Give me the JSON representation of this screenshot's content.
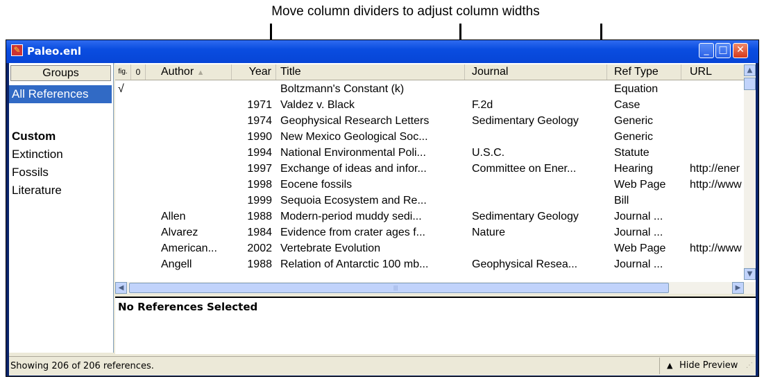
{
  "callout": {
    "text": "Move column dividers to adjust column widths"
  },
  "window": {
    "title": "Paleo.enl"
  },
  "title_buttons": {
    "minimize": "_",
    "maximize": "□",
    "close": "✕"
  },
  "groups": {
    "header": "Groups",
    "all_references": "All References",
    "custom_header": "Custom",
    "items": [
      "Extinction",
      "Fossils",
      "Literature"
    ]
  },
  "columns": {
    "figure": "fig.",
    "attachment": "0",
    "author": "Author",
    "sort_indicator": "▲",
    "year": "Year",
    "title": "Title",
    "journal": "Journal",
    "reftype": "Ref Type",
    "url": "URL"
  },
  "references": [
    {
      "check": "√",
      "author": "",
      "year": "",
      "title": "Boltzmann's Constant (k)",
      "journal": "",
      "reftype": "Equation",
      "url": ""
    },
    {
      "check": "",
      "author": "",
      "year": "1971",
      "title": "Valdez v. Black",
      "journal": "F.2d",
      "reftype": "Case",
      "url": ""
    },
    {
      "check": "",
      "author": "",
      "year": "1974",
      "title": "Geophysical Research Letters",
      "journal": "Sedimentary Geology",
      "reftype": "Generic",
      "url": ""
    },
    {
      "check": "",
      "author": "",
      "year": "1990",
      "title": "New Mexico Geological Soc...",
      "journal": "",
      "reftype": "Generic",
      "url": ""
    },
    {
      "check": "",
      "author": "",
      "year": "1994",
      "title": "National Environmental Poli...",
      "journal": "U.S.C.",
      "reftype": "Statute",
      "url": ""
    },
    {
      "check": "",
      "author": "",
      "year": "1997",
      "title": "Exchange of ideas and infor...",
      "journal": "Committee on Ener...",
      "reftype": "Hearing",
      "url": "http://ener"
    },
    {
      "check": "",
      "author": "",
      "year": "1998",
      "title": "Eocene fossils",
      "journal": "",
      "reftype": "Web Page",
      "url": "http://www"
    },
    {
      "check": "",
      "author": "",
      "year": "1999",
      "title": "Sequoia Ecosystem and Re...",
      "journal": "",
      "reftype": "Bill",
      "url": ""
    },
    {
      "check": "",
      "author": "Allen",
      "year": "1988",
      "title": "Modern-period muddy sedi...",
      "journal": "Sedimentary Geology",
      "reftype": "Journal ...",
      "url": ""
    },
    {
      "check": "",
      "author": "Alvarez",
      "year": "1984",
      "title": "Evidence from crater ages f...",
      "journal": "Nature",
      "reftype": "Journal ...",
      "url": ""
    },
    {
      "check": "",
      "author": "American...",
      "year": "2002",
      "title": "Vertebrate Evolution",
      "journal": "",
      "reftype": "Web Page",
      "url": "http://www"
    },
    {
      "check": "",
      "author": "Angell",
      "year": "1988",
      "title": "Relation of Antarctic 100 mb...",
      "journal": "Geophysical Resea...",
      "reftype": "Journal ...",
      "url": ""
    }
  ],
  "scroll": {
    "up": "▲",
    "down": "▼",
    "left": "◀",
    "right": "▶",
    "grip": "|||"
  },
  "preview": {
    "text": "No References Selected"
  },
  "status": {
    "text": "Showing 206 of 206 references.",
    "hide_preview": "Hide Preview",
    "hide_icon": "▲",
    "grip": "⋰"
  },
  "colors": {
    "selection": "#316ac5",
    "titlebar": "#0a4de0",
    "chrome": "#ece9d8"
  }
}
